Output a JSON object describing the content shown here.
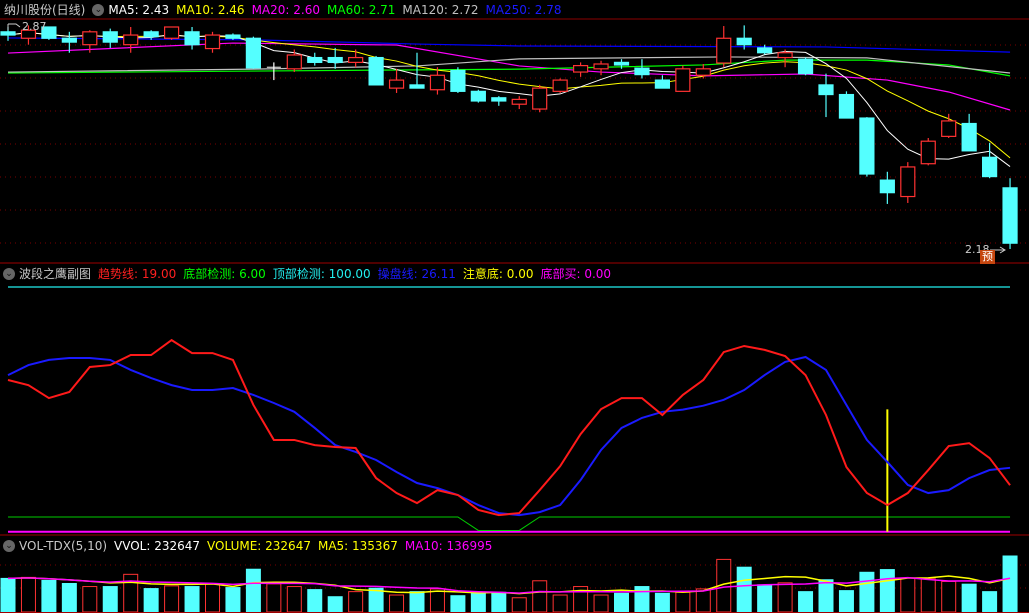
{
  "main_header": {
    "title": "纳川股份(日线)",
    "ma5": "MA5: 2.43",
    "ma10": "MA10: 2.46",
    "ma20": "MA20: 2.60",
    "ma60": "MA60: 2.71",
    "ma120": "MA120: 2.72",
    "ma250": "MA250: 2.78"
  },
  "price_labels": {
    "high": "2.87",
    "low": "2.18",
    "badge": "预"
  },
  "indicator_header": {
    "title": "波段之鹰副图",
    "trend": "趋势线: 19.00",
    "bottom_detect": "底部检测: 6.00",
    "top_detect": "顶部检测: 100.00",
    "operate": "操盘线: 26.11",
    "attention": "注意底: 0.00",
    "bottom_buy": "底部买: 0.00"
  },
  "volume_header": {
    "title": "VOL-TDX(5,10)",
    "vvol": "VVOL: 232647",
    "volume": "VOLUME: 232647",
    "ma5": "MA5: 135367",
    "ma10": "MA10: 136995"
  },
  "colors": {
    "up": "#ff3232",
    "down": "#54ffff",
    "ma5": "#ffffff",
    "ma10": "#ffff00",
    "ma20": "#ff00ff",
    "ma60": "#00ff00",
    "ma120": "#c0c0c0",
    "ma250": "#0000ff"
  },
  "chart_data": [
    {
      "type": "candlestick",
      "title": "纳川股份(日线)",
      "price_range": [
        2.18,
        2.87
      ],
      "ohlc": [
        [
          2.855,
          2.87,
          2.827,
          2.845
        ],
        [
          2.835,
          2.875,
          2.815,
          2.86
        ],
        [
          2.87,
          2.87,
          2.83,
          2.835
        ],
        [
          2.835,
          2.855,
          2.79,
          2.823
        ],
        [
          2.815,
          2.86,
          2.79,
          2.855
        ],
        [
          2.855,
          2.865,
          2.805,
          2.823
        ],
        [
          2.815,
          2.87,
          2.79,
          2.845
        ],
        [
          2.855,
          2.86,
          2.83,
          2.84
        ],
        [
          2.835,
          2.87,
          2.83,
          2.87
        ],
        [
          2.855,
          2.87,
          2.8,
          2.815
        ],
        [
          2.803,
          2.855,
          2.79,
          2.845
        ],
        [
          2.845,
          2.85,
          2.83,
          2.835
        ],
        [
          2.835,
          2.84,
          2.74,
          2.743
        ],
        [
          2.745,
          2.76,
          2.705,
          2.745
        ],
        [
          2.74,
          2.8,
          2.73,
          2.783
        ],
        [
          2.775,
          2.79,
          2.75,
          2.76
        ],
        [
          2.775,
          2.805,
          2.74,
          2.76
        ],
        [
          2.76,
          2.8,
          2.745,
          2.775
        ],
        [
          2.775,
          2.78,
          2.69,
          2.69
        ],
        [
          2.68,
          2.74,
          2.665,
          2.705
        ],
        [
          2.69,
          2.79,
          2.68,
          2.68
        ],
        [
          2.675,
          2.745,
          2.66,
          2.72
        ],
        [
          2.735,
          2.745,
          2.665,
          2.67
        ],
        [
          2.67,
          2.675,
          2.635,
          2.64
        ],
        [
          2.65,
          2.655,
          2.625,
          2.64
        ],
        [
          2.63,
          2.655,
          2.615,
          2.645
        ],
        [
          2.615,
          2.69,
          2.605,
          2.68
        ],
        [
          2.67,
          2.71,
          2.665,
          2.705
        ],
        [
          2.73,
          2.76,
          2.715,
          2.75
        ],
        [
          2.74,
          2.765,
          2.72,
          2.755
        ],
        [
          2.76,
          2.77,
          2.74,
          2.752
        ],
        [
          2.742,
          2.77,
          2.71,
          2.722
        ],
        [
          2.705,
          2.72,
          2.68,
          2.68
        ],
        [
          2.67,
          2.75,
          2.67,
          2.74
        ],
        [
          2.72,
          2.755,
          2.71,
          2.74
        ],
        [
          2.758,
          2.873,
          2.745,
          2.835
        ],
        [
          2.835,
          2.875,
          2.8,
          2.815
        ],
        [
          2.805,
          2.815,
          2.785,
          2.79
        ],
        [
          2.775,
          2.8,
          2.745,
          2.79
        ],
        [
          2.77,
          2.775,
          2.72,
          2.725
        ],
        [
          2.69,
          2.725,
          2.59,
          2.66
        ],
        [
          2.66,
          2.67,
          2.587,
          2.587
        ],
        [
          2.587,
          2.59,
          2.405,
          2.413
        ],
        [
          2.394,
          2.42,
          2.32,
          2.355
        ],
        [
          2.343,
          2.45,
          2.323,
          2.435
        ],
        [
          2.445,
          2.525,
          2.44,
          2.515
        ],
        [
          2.53,
          2.6,
          2.525,
          2.578
        ],
        [
          2.57,
          2.6,
          2.485,
          2.485
        ],
        [
          2.465,
          2.51,
          2.4,
          2.405
        ],
        [
          2.37,
          2.4,
          2.18,
          2.198
        ]
      ],
      "ma_sparse": {
        "ma20": [
          [
            0,
            2.789
          ],
          [
            11,
            2.82
          ],
          [
            19,
            2.814
          ],
          [
            25,
            2.749
          ],
          [
            29,
            2.73
          ],
          [
            34,
            2.718
          ],
          [
            39,
            2.724
          ],
          [
            43,
            2.705
          ],
          [
            46,
            2.668
          ],
          [
            49,
            2.612
          ]
        ],
        "ma60": [
          [
            0,
            2.727
          ],
          [
            12,
            2.733
          ],
          [
            25,
            2.739
          ],
          [
            34,
            2.752
          ],
          [
            38,
            2.767
          ],
          [
            42,
            2.767
          ],
          [
            46,
            2.752
          ],
          [
            49,
            2.718
          ]
        ],
        "ma120": [
          [
            0,
            2.73
          ],
          [
            12,
            2.739
          ],
          [
            20,
            2.749
          ],
          [
            25,
            2.771
          ],
          [
            35,
            2.777
          ],
          [
            42,
            2.774
          ],
          [
            49,
            2.727
          ]
        ],
        "ma250": [
          [
            0,
            2.836
          ],
          [
            12,
            2.83
          ],
          [
            20,
            2.817
          ],
          [
            25,
            2.811
          ],
          [
            40,
            2.808
          ],
          [
            49,
            2.792
          ]
        ]
      }
    },
    {
      "type": "line",
      "title": "波段之鹰副图",
      "ylim": [
        0,
        100
      ],
      "series": [
        {
          "name": "趋势线",
          "values": [
            62,
            59.9,
            54.6,
            57.1,
            67.3,
            68.1,
            72.2,
            72.2,
            78.3,
            73,
            73,
            70.2,
            51.8,
            37.5,
            37.5,
            35.4,
            34.6,
            34.2,
            21.9,
            15.8,
            11.7,
            17,
            15,
            8.9,
            6.8,
            7.6,
            17,
            26.8,
            39.9,
            50.1,
            54.6,
            54.6,
            47.7,
            55.9,
            62,
            73.4,
            75.9,
            74.3,
            71.8,
            64,
            47.7,
            26.4,
            15.8,
            10.9,
            15.8,
            25.2,
            35,
            36.2,
            30.1,
            19
          ]
        },
        {
          "name": "操盘线",
          "values": [
            64,
            68.1,
            70.2,
            71,
            71,
            70.2,
            66.1,
            62.8,
            59.9,
            57.9,
            57.9,
            58.7,
            55.9,
            52.6,
            49,
            42.4,
            35.4,
            32.6,
            29.3,
            24.4,
            19.9,
            17.8,
            15,
            10.9,
            7.6,
            6.8,
            8,
            10.9,
            21.1,
            33.4,
            42.4,
            46.5,
            49,
            49.9,
            51.5,
            53.9,
            57.9,
            64,
            69.4,
            71.4,
            66.1,
            51.8,
            37.5,
            28.5,
            19.1,
            15.8,
            17,
            21.9,
            25.2,
            26.11
          ]
        },
        {
          "name": "底部检测",
          "values": [
            6,
            6,
            6,
            6,
            6,
            6,
            6,
            6,
            6,
            6,
            6,
            6,
            6,
            6,
            6,
            6,
            6,
            6,
            6,
            6,
            6,
            6,
            6,
            0.5,
            0.5,
            0.5,
            6,
            6,
            6,
            6,
            6,
            6,
            6,
            6,
            6,
            6,
            6,
            6,
            6,
            6,
            6,
            6,
            6,
            6,
            6,
            6,
            6,
            6,
            6,
            6
          ]
        },
        {
          "name": "顶部检测",
          "value": 100
        },
        {
          "name": "底部买",
          "value": 0
        }
      ],
      "attention_signal": {
        "index": 43,
        "value": 50
      }
    },
    {
      "type": "bar",
      "title": "VOL-TDX(5,10)",
      "values": [
        139600,
        143800,
        131100,
        118400,
        105700,
        105700,
        156500,
        97300,
        108600,
        105700,
        115600,
        101500,
        177700,
        117000,
        105700,
        93100,
        63500,
        84600,
        98700,
        70500,
        84600,
        95900,
        67700,
        77600,
        81800,
        59200,
        129700,
        70500,
        105700,
        70500,
        77600,
        105700,
        77600,
        81800,
        95900,
        218500,
        186100,
        112800,
        121300,
        84600,
        134000,
        88800,
        165000,
        176200,
        141000,
        138200,
        126900,
        115600,
        84600,
        232647
      ]
    }
  ]
}
